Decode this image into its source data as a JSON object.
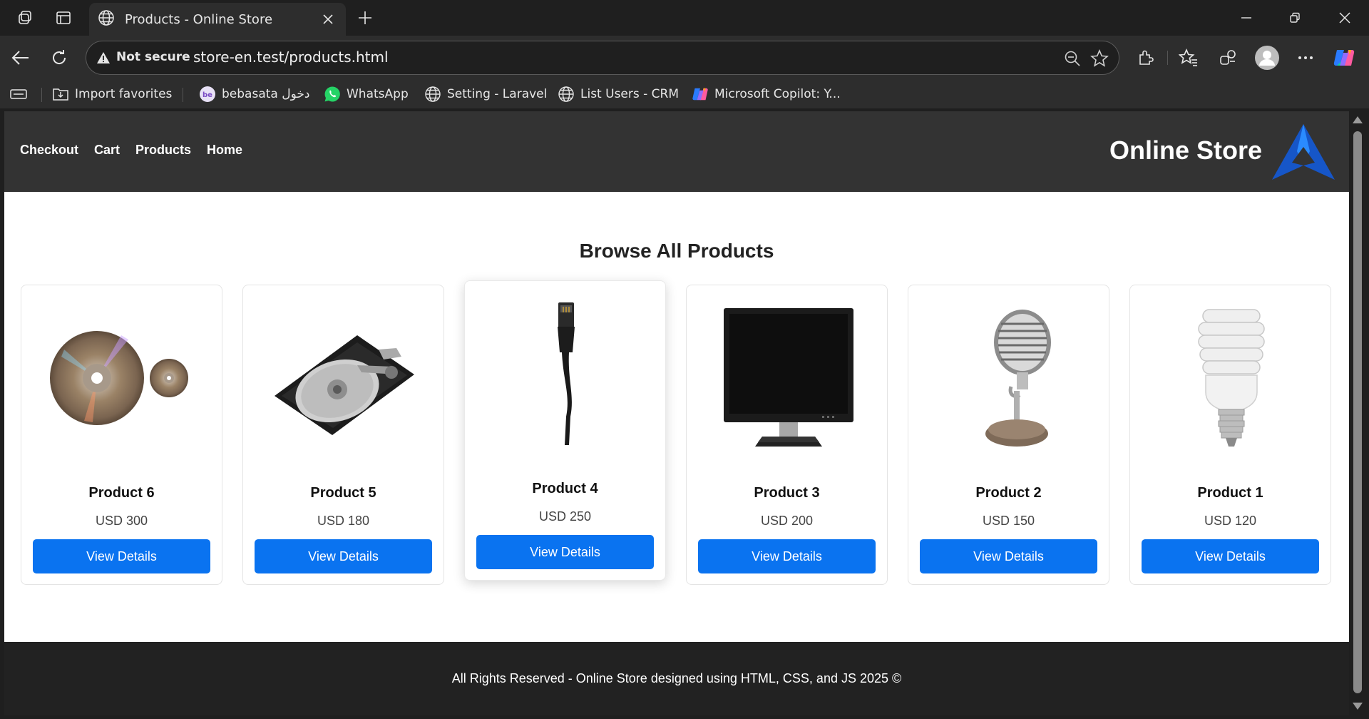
{
  "browser": {
    "tab_title": "Products - Online Store",
    "security_label": "Not secure",
    "url": "store-en.test/products.html",
    "bookmarks": [
      {
        "label": "Import favorites",
        "icon": "import-icon"
      },
      {
        "label": "bebasata دخول",
        "icon": "bebasata-icon"
      },
      {
        "label": "WhatsApp",
        "icon": "whatsapp-icon"
      },
      {
        "label": "Setting - Laravel",
        "icon": "globe-icon"
      },
      {
        "label": "List Users - CRM",
        "icon": "globe-icon"
      },
      {
        "label": "Microsoft Copilot: Y...",
        "icon": "copilot-icon"
      }
    ]
  },
  "site": {
    "nav": [
      "Checkout",
      "Cart",
      "Products",
      "Home"
    ],
    "brand": "Online Store",
    "heading": "Browse All Products",
    "button_label": "View Details",
    "footer": "All Rights Reserved - Online Store designed using HTML, CSS, and JS 2025 ©"
  },
  "products": [
    {
      "name": "Product 6",
      "price": "USD 300",
      "image": "compact-discs"
    },
    {
      "name": "Product 5",
      "price": "USD 180",
      "image": "hard-drive"
    },
    {
      "name": "Product 4",
      "price": "USD 250",
      "image": "network-cable"
    },
    {
      "name": "Product 3",
      "price": "USD 200",
      "image": "monitor"
    },
    {
      "name": "Product 2",
      "price": "USD 150",
      "image": "microphone"
    },
    {
      "name": "Product 1",
      "price": "USD 120",
      "image": "light-bulb"
    }
  ],
  "colors": {
    "header_bg": "#333333",
    "button": "#0a73f0",
    "footer_bg": "#222222",
    "logo": "#1656c8"
  }
}
